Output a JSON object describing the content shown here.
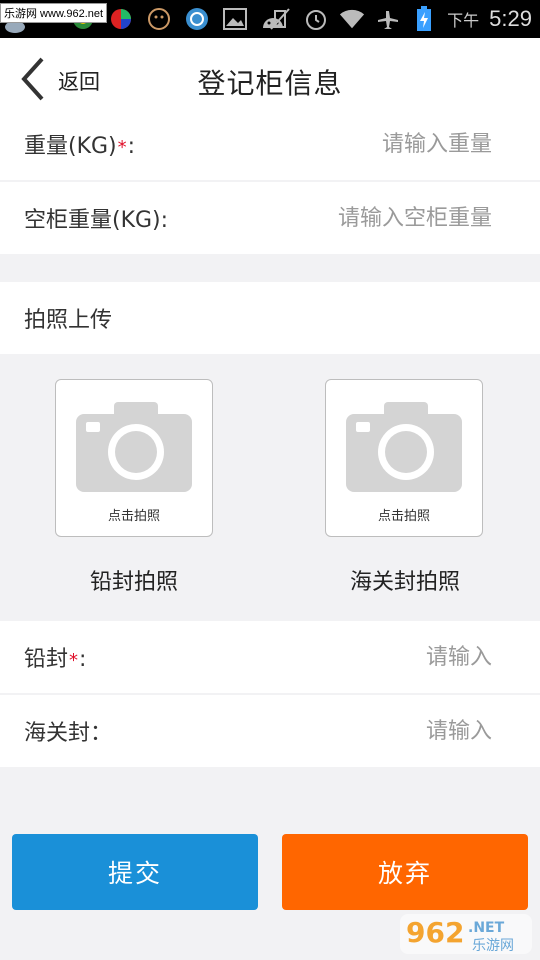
{
  "status_bar": {
    "watermark": "乐游网 www.962.net",
    "ampm": "下午",
    "time": "5:29"
  },
  "nav": {
    "back_label": "返回",
    "title": "登记柜信息"
  },
  "form": {
    "weight": {
      "label": "重量(KG)",
      "required": "*",
      "colon": ":",
      "placeholder": "请输入重量"
    },
    "empty_weight": {
      "label": "空柜重量(KG):",
      "placeholder": "请输入空柜重量"
    },
    "seal": {
      "label": "铅封",
      "required": "*",
      "colon": ":",
      "placeholder": "请输入"
    },
    "customs_seal": {
      "label": "海关封：",
      "placeholder": "请输入"
    }
  },
  "photo_section": {
    "title": "拍照上传",
    "items": [
      {
        "tap_label": "点击拍照",
        "caption": "铅封拍照"
      },
      {
        "tap_label": "点击拍照",
        "caption": "海关封拍照"
      }
    ]
  },
  "actions": {
    "submit_label": "提交",
    "abandon_label": "放弃"
  },
  "watermark_logo": {
    "number": "962",
    "suffix": ".NET",
    "name": "乐游网"
  },
  "colors": {
    "submit": "#1a90d8",
    "abandon": "#ff6600",
    "required_star": "#e0102a",
    "background": "#f2f2f4"
  }
}
